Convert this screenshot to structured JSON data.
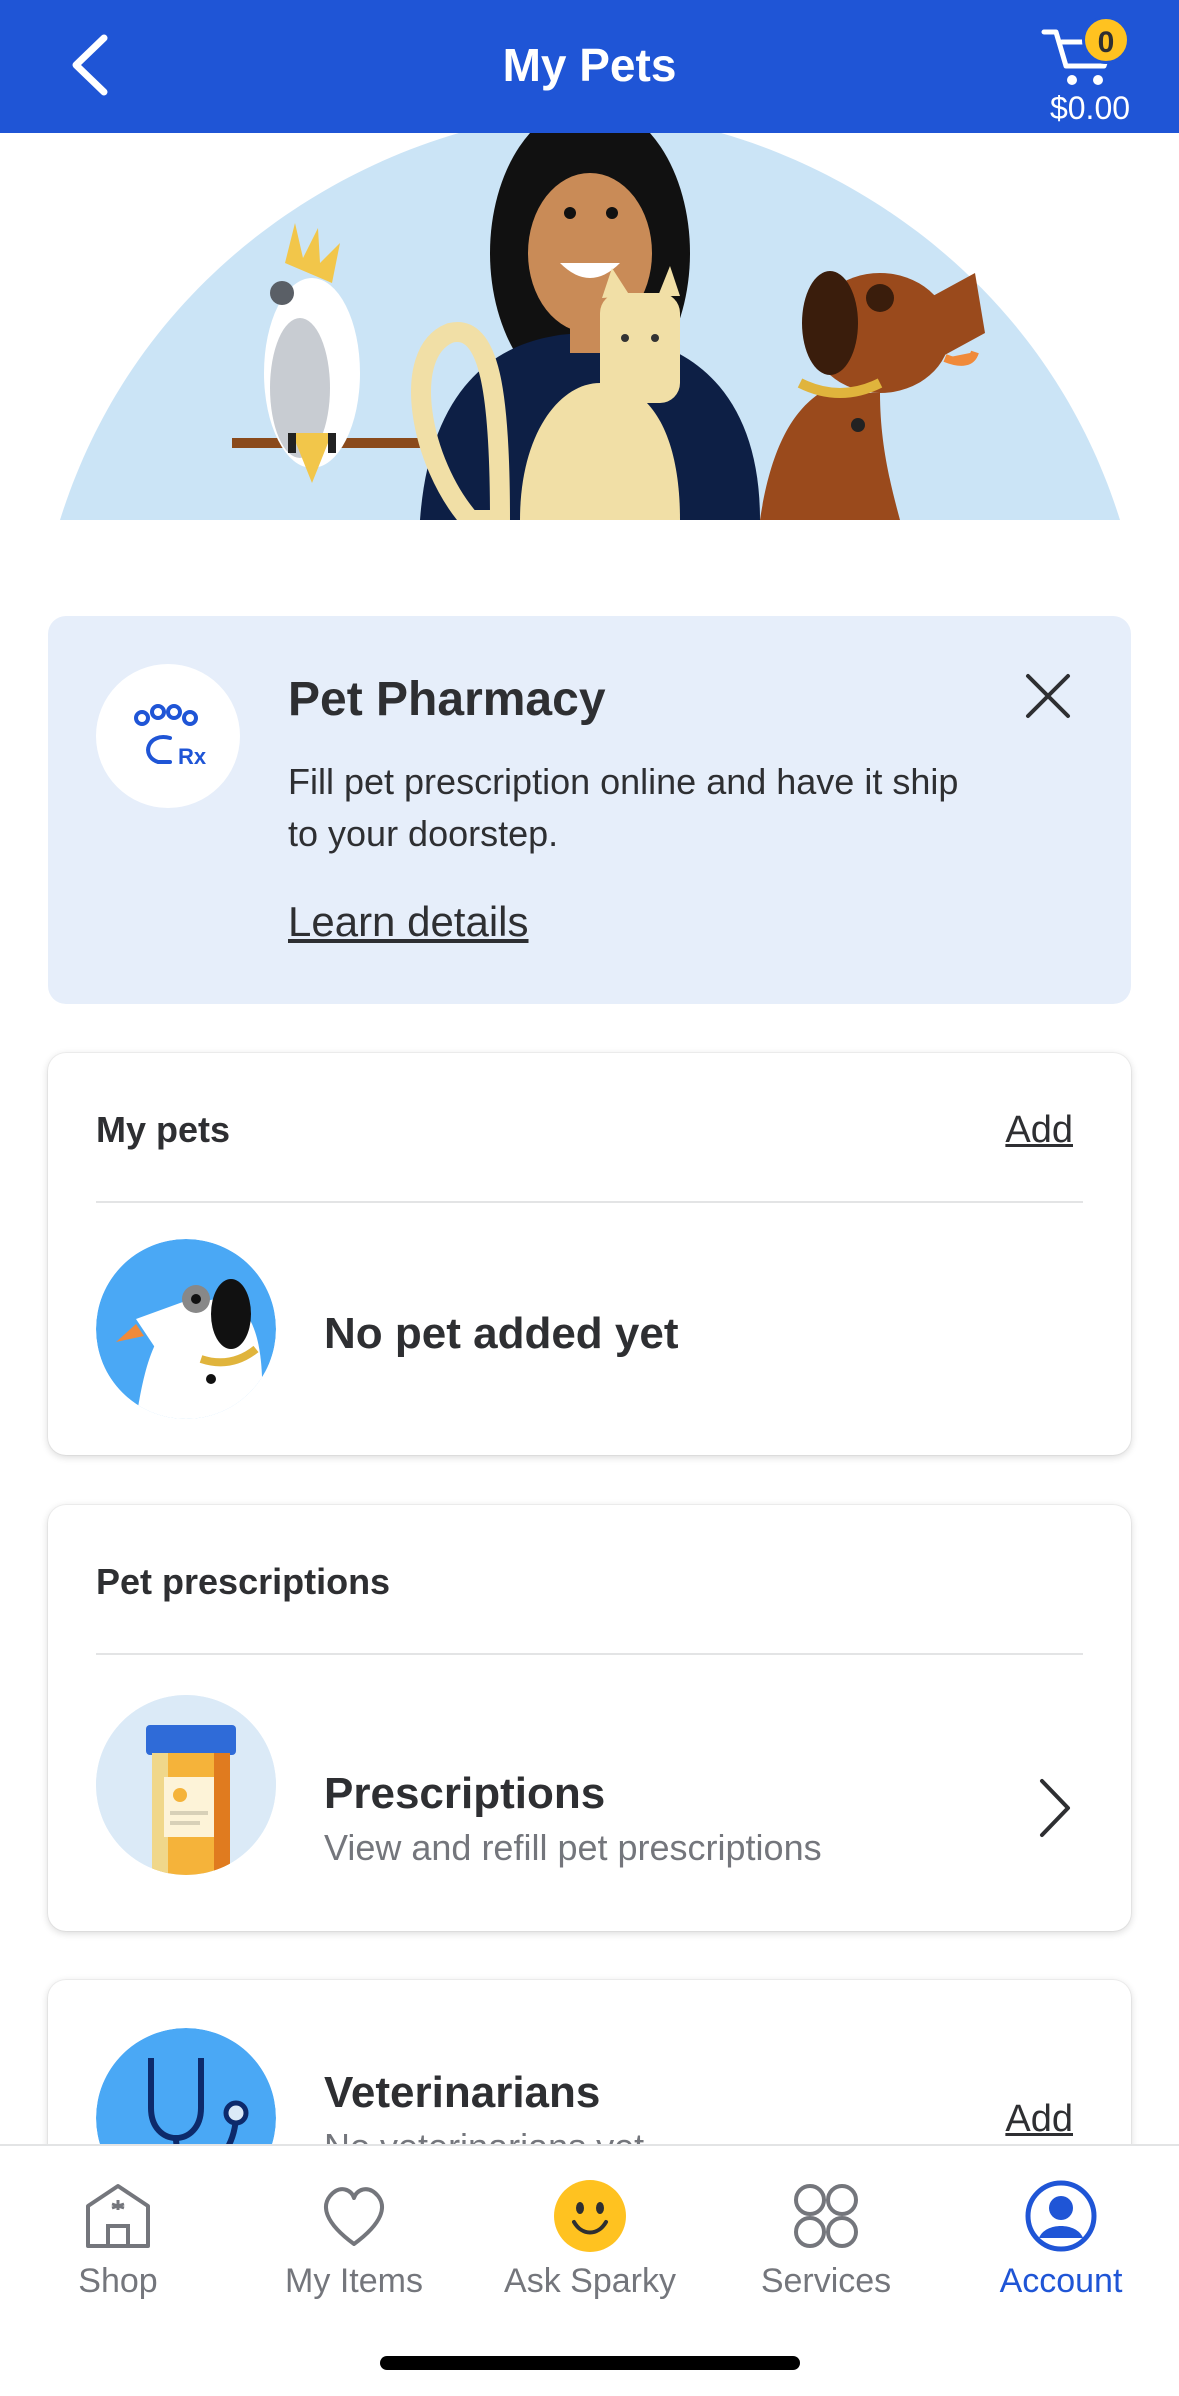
{
  "header": {
    "title": "My Pets",
    "cart_count": "0",
    "cart_total": "$0.00"
  },
  "promo": {
    "title": "Pet Pharmacy",
    "description": "Fill pet prescription online and have it ship to your doorstep.",
    "link": "Learn details"
  },
  "my_pets": {
    "heading": "My pets",
    "add_label": "Add",
    "empty_text": "No pet added yet"
  },
  "prescriptions": {
    "heading": "Pet prescriptions",
    "title": "Prescriptions",
    "subtitle": "View and refill pet prescriptions"
  },
  "veterinarians": {
    "title": "Veterinarians",
    "subtitle": "No veterinarians yet",
    "add_label": "Add"
  },
  "bottom_nav": {
    "items": [
      {
        "label": "Shop",
        "icon": "store-icon"
      },
      {
        "label": "My Items",
        "icon": "heart-icon"
      },
      {
        "label": "Ask Sparky",
        "icon": "sparky-smile-icon"
      },
      {
        "label": "Services",
        "icon": "grid-circles-icon"
      },
      {
        "label": "Account",
        "icon": "account-icon"
      }
    ],
    "active": "Account"
  },
  "colors": {
    "brand_blue": "#1f55d6",
    "badge_yellow": "#ffc220",
    "promo_bg": "#e6eefa",
    "hero_bg": "#dfeefa"
  }
}
